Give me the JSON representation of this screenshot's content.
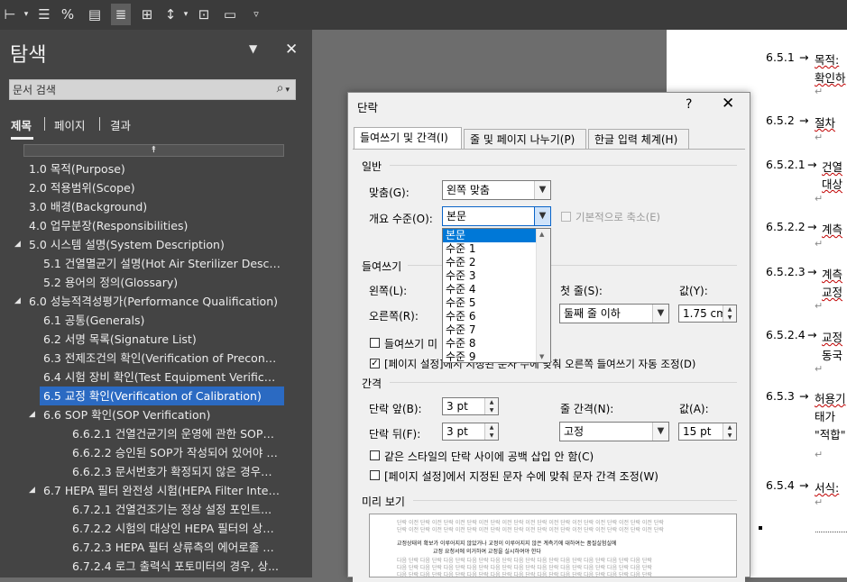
{
  "ribbon": {
    "icons": [
      "insert-line-icon",
      "numbered-list-icon",
      "percent-style-icon",
      "table-icon",
      "bullet-list-icon",
      "grid-icon",
      "line-spacing-icon",
      "borders-icon",
      "field-icon",
      "more-icon"
    ]
  },
  "nav": {
    "title": "탐색",
    "title_arrow": "▼",
    "close": "✕",
    "search_placeholder": "문서 검색",
    "search_icon": "⌕",
    "search_dropdown": "▾",
    "tabs": [
      "제목",
      "페이지",
      "결과"
    ],
    "collapse_icon": "⯭",
    "items": [
      {
        "label": "1.0 목적(Purpose)"
      },
      {
        "label": "2.0 적용범위(Scope)"
      },
      {
        "label": "3.0 배경(Background)"
      },
      {
        "label": "4.0 업무분장(Responsibilities)"
      },
      {
        "label": "5.0 시스템 설명(System Description)",
        "toggle": "◢"
      },
      {
        "label": "5.1 건열멸균기 설명(Hot Air Sterilizer Descripti..."
      },
      {
        "label": "5.2 용어의 정의(Glossary)"
      },
      {
        "label": "6.0 성능적격성평가(Performance Qualification)",
        "toggle": "◢"
      },
      {
        "label": "6.1 공통(Generals)"
      },
      {
        "label": "6.2 서명 목록(Signature List)"
      },
      {
        "label": "6.3 전제조건의 확인(Verification of Precondition)"
      },
      {
        "label": "6.4 시험 장비 확인(Test Equipment Verification)"
      },
      {
        "label": "6.5 교정 확인(Verification of Calibration)"
      },
      {
        "label": "6.6 SOP 확인(SOP Verification)",
        "toggle": "◢"
      },
      {
        "label": "6.6.2.1 건열건균기의 운영에 관한 SOP가..."
      },
      {
        "label": "6.6.2.2 승인된 SOP가 작성되어 있어야 한..."
      },
      {
        "label": "6.6.2.3 문서번호가 확정되지 않은 경우에..."
      },
      {
        "label": "6.7 HEPA 필터 완전성 시험(HEPA Filter Integrit...",
        "toggle": "◢"
      },
      {
        "label": "6.7.2.1 건열건조기는 정상 설정 포인트..."
      },
      {
        "label": "6.7.2.2 시험의 대상인 HEPA 필터의 상류..."
      },
      {
        "label": "6.7.2.3 HEPA 필터 상류측의 에어로졸 검..."
      },
      {
        "label": "6.7.2.4 로그 출력식 포토미터의 경우, 상..."
      }
    ]
  },
  "doc": {
    "lines": [
      {
        "num": "6.5.1",
        "text": "목적:"
      },
      {
        "num": "",
        "text": "확인하"
      },
      {
        "num": "6.5.2",
        "text": "절차"
      },
      {
        "num": "6.5.2.1",
        "text": "건열"
      },
      {
        "num": "",
        "text": "대상"
      },
      {
        "num": "6.5.2.2",
        "text": "계측"
      },
      {
        "num": "6.5.2.3",
        "text": "계측"
      },
      {
        "num": "",
        "text": "교정"
      },
      {
        "num": "6.5.2.4",
        "text": "교정"
      },
      {
        "num": "",
        "text": "동국"
      },
      {
        "num": "6.5.3",
        "text": "허용기"
      },
      {
        "num": "",
        "text": "태가"
      },
      {
        "num": "",
        "text": "\"적합\""
      },
      {
        "num": "6.5.4",
        "text": "서식:"
      }
    ],
    "arrow": "→",
    "return": "↵"
  },
  "dialog": {
    "title": "단락",
    "help": "?",
    "close": "✕",
    "tabs": [
      "들여쓰기 및 간격(I)",
      "줄 및 페이지 나누기(P)",
      "한글 입력 체계(H)"
    ],
    "section_general": "일반",
    "align_label": "맞춤(G):",
    "align_value": "왼쪽 맞춤",
    "outline_label": "개요 수준(O):",
    "outline_value": "본문",
    "collapsed_label": "기본적으로 축소(E)",
    "outline_options": [
      "본문",
      "수준 1",
      "수준 2",
      "수준 3",
      "수준 4",
      "수준 5",
      "수준 6",
      "수준 7",
      "수준 8",
      "수준 9"
    ],
    "section_indent": "들여쓰기",
    "left_label": "왼쪽(L):",
    "right_label": "오른쪽(R):",
    "first_line_label": "첫 줄(S):",
    "first_line_value": "둘째 줄 이하",
    "by_label": "값(Y):",
    "by_value": "1.75 cm",
    "mirror_label": "들여쓰기 미",
    "auto_indent_label": "[페이지 설정]에서 지정된 문자 수에 맞춰 오른쪽 들여쓰기 자동 조정(D)",
    "section_spacing": "간격",
    "before_label": "단락 앞(B):",
    "before_value": "3 pt",
    "after_label": "단락 뒤(F):",
    "after_value": "3 pt",
    "line_spacing_label": "줄 간격(N):",
    "line_spacing_value": "고정",
    "at_label": "값(A):",
    "at_value": "15 pt",
    "no_space_label": "같은 스타일의 단락 사이에 공백 삽입 안 함(C)",
    "snap_grid_label": "[페이지 설정]에서 지정된 문자 수에 맞춰 문자 간격 조정(W)",
    "section_preview": "미리 보기",
    "preview_prev": "단락 이전 단락 이전 단락 이전 단락 이전 단락 이전 단락 이전 단락 이전 단락 이전 단락 이전 단락 이전 단락 이전 단락",
    "preview_text": "교정상태의 확보가 이루어지지 않았거나 교정이 이루어지지 않은 계측기에 대하여는 품질실험실에",
    "preview_text2": "교정 요청서에 의거하여 교정을 실시하여야 한다",
    "preview_next": "다음 단락 다음 단락 다음 단락 다음 단락 다음 단락 다음 단락 다음 단락 다음 단락 다음 단락 다음 단락 다음 단락"
  }
}
